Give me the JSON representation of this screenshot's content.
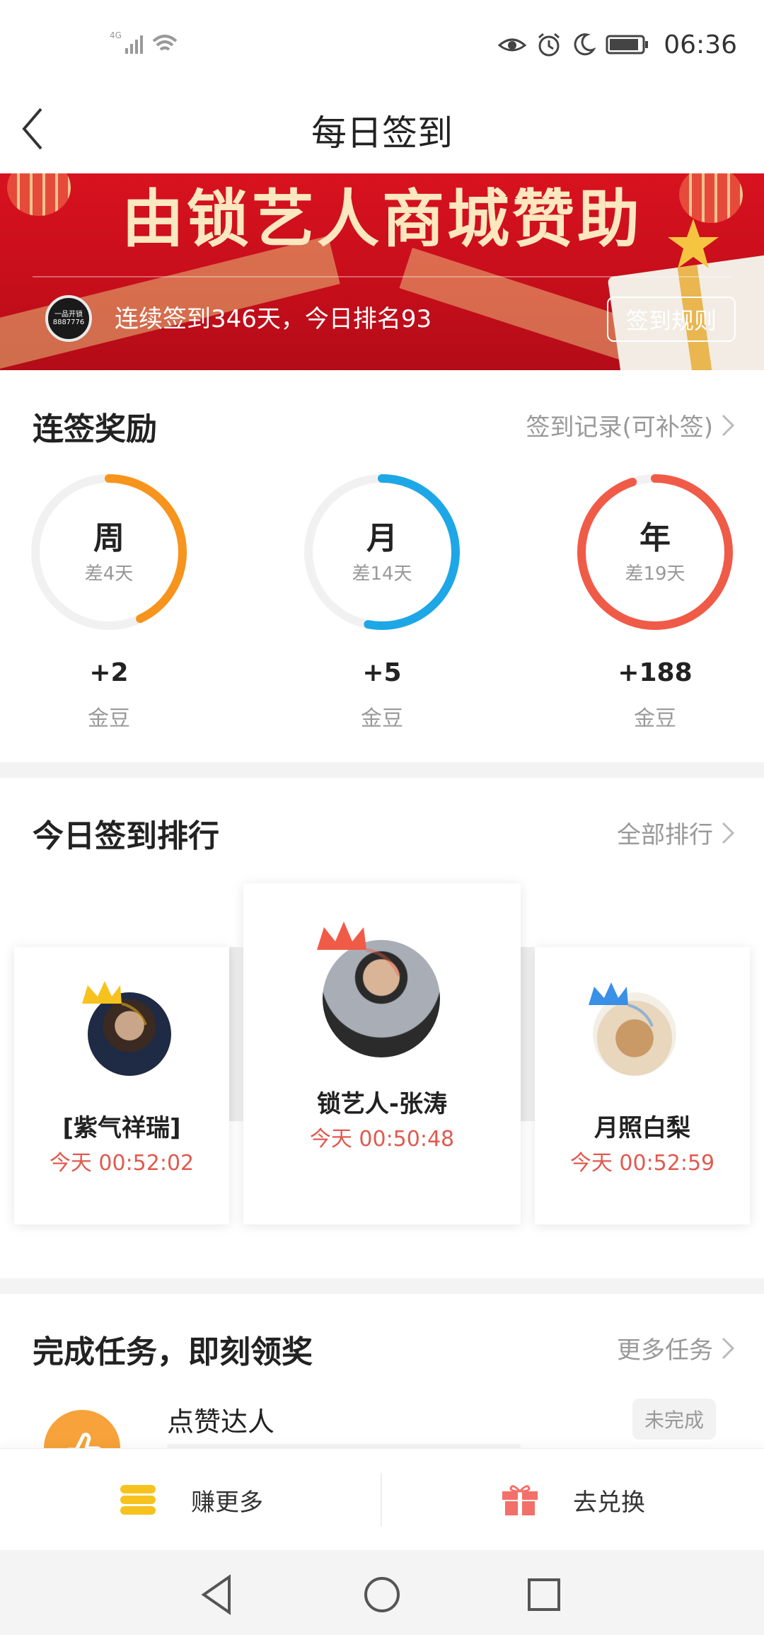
{
  "status_bar": {
    "time": "06:36",
    "network": "4G"
  },
  "nav": {
    "title": "每日签到"
  },
  "banner": {
    "title": "由锁艺人商城赞助",
    "logo_lines": [
      "一品开锁",
      "8887776"
    ],
    "streak_text": "连续签到346天，今日排名93",
    "rules_button": "签到规则"
  },
  "streak_rewards": {
    "title": "连签奖励",
    "link": "签到记录(可补签)",
    "items": [
      {
        "label": "周",
        "remaining": "差4天",
        "reward": "+2",
        "unit": "金豆",
        "color": "#f7941d",
        "progress": 0.43
      },
      {
        "label": "月",
        "remaining": "差14天",
        "reward": "+5",
        "unit": "金豆",
        "color": "#1ea7e6",
        "progress": 0.53
      },
      {
        "label": "年",
        "remaining": "差19天",
        "reward": "+188",
        "unit": "金豆",
        "color": "#f05b48",
        "progress": 0.95
      }
    ]
  },
  "ranking": {
    "title": "今日签到排行",
    "link": "全部排行",
    "users": [
      {
        "name": "[紫气祥瑞]",
        "time": "今天 00:52:02",
        "crown_color": "#f7c21e"
      },
      {
        "name": "锁艺人-张涛",
        "time": "今天 00:50:48",
        "crown_color": "#f05b48"
      },
      {
        "name": "月照白梨",
        "time": "今天 00:52:59",
        "crown_color": "#3a8fe6"
      }
    ]
  },
  "tasks": {
    "title": "完成任务，即刻领奖",
    "link": "更多任务",
    "items": [
      {
        "name": "点赞达人",
        "status": "未完成"
      }
    ]
  },
  "actions": {
    "earn": "赚更多",
    "exchange": "去兑换"
  }
}
